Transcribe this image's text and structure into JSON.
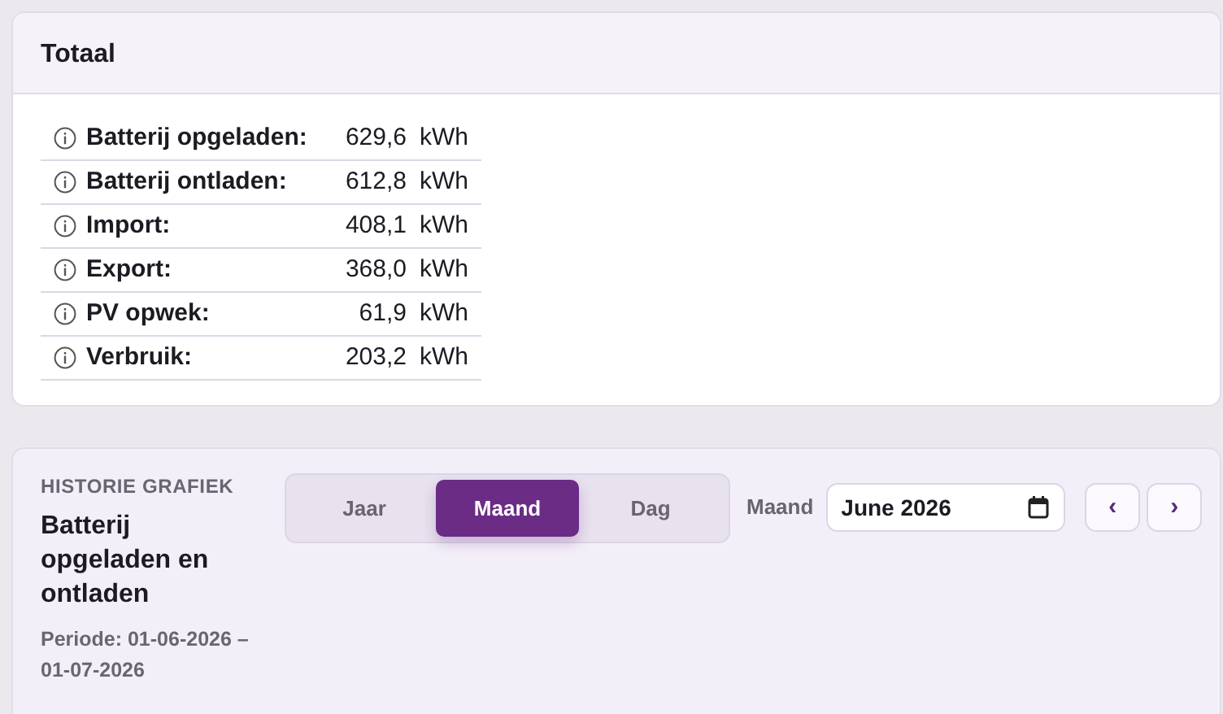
{
  "totals": {
    "title": "Totaal",
    "rows": [
      {
        "label": "Batterij opgeladen:",
        "value": "629,6",
        "unit": "kWh"
      },
      {
        "label": "Batterij ontladen:",
        "value": "612,8",
        "unit": "kWh"
      },
      {
        "label": "Import:",
        "value": "408,1",
        "unit": "kWh"
      },
      {
        "label": "Export:",
        "value": "368,0",
        "unit": "kWh"
      },
      {
        "label": "PV opwek:",
        "value": "61,9",
        "unit": "kWh"
      },
      {
        "label": "Verbruik:",
        "value": "203,2",
        "unit": "kWh"
      }
    ]
  },
  "history": {
    "eyebrow": "HISTORIE GRAFIEK",
    "title": "Batterij opgeladen en ontladen",
    "period": "Periode: 01-06-2026 – 01-07-2026",
    "tabs": [
      {
        "label": "Jaar",
        "selected": false
      },
      {
        "label": "Maand",
        "selected": true
      },
      {
        "label": "Dag",
        "selected": false
      }
    ],
    "date_label": "Maand",
    "date_value": "June 2026",
    "prev": "‹",
    "next": "›"
  }
}
